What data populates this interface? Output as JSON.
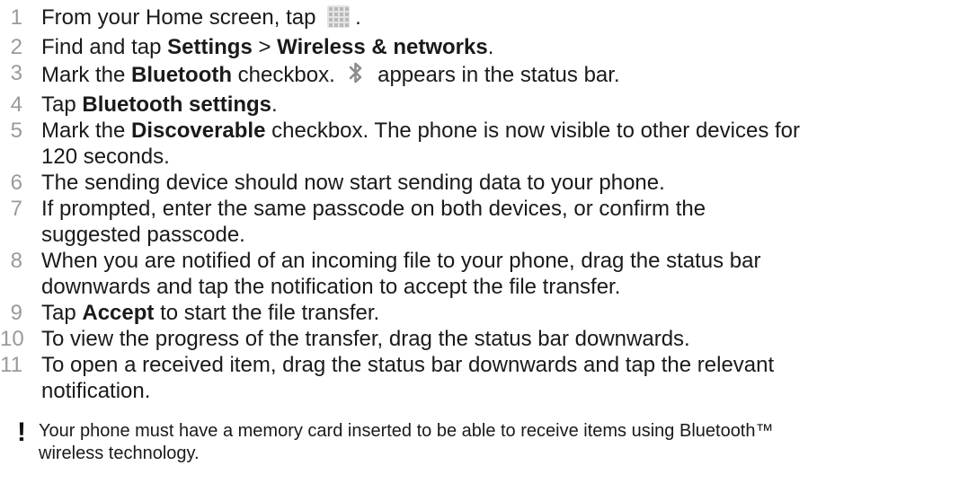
{
  "steps": [
    {
      "num": "1",
      "parts": [
        {
          "t": "text",
          "v": "From your Home screen, tap "
        },
        {
          "t": "icon",
          "v": "app-grid-icon"
        },
        {
          "t": "text",
          "v": "."
        }
      ]
    },
    {
      "num": "2",
      "parts": [
        {
          "t": "text",
          "v": "Find and tap "
        },
        {
          "t": "bold",
          "v": "Settings"
        },
        {
          "t": "text",
          "v": " > "
        },
        {
          "t": "bold",
          "v": "Wireless & networks"
        },
        {
          "t": "text",
          "v": "."
        }
      ]
    },
    {
      "num": "3",
      "parts": [
        {
          "t": "text",
          "v": "Mark the "
        },
        {
          "t": "bold",
          "v": "Bluetooth"
        },
        {
          "t": "text",
          "v": " checkbox. "
        },
        {
          "t": "icon",
          "v": "bluetooth-icon"
        },
        {
          "t": "text",
          "v": " appears in the status bar."
        }
      ]
    },
    {
      "num": "4",
      "parts": [
        {
          "t": "text",
          "v": "Tap "
        },
        {
          "t": "bold",
          "v": "Bluetooth settings"
        },
        {
          "t": "text",
          "v": "."
        }
      ]
    },
    {
      "num": "5",
      "parts": [
        {
          "t": "text",
          "v": "Mark the "
        },
        {
          "t": "bold",
          "v": "Discoverable"
        },
        {
          "t": "text",
          "v": " checkbox. The phone is now visible to other devices for"
        },
        {
          "t": "br"
        },
        {
          "t": "text",
          "v": "120 seconds."
        }
      ]
    },
    {
      "num": "6",
      "parts": [
        {
          "t": "text",
          "v": "The sending device should now start sending data to your phone."
        }
      ]
    },
    {
      "num": "7",
      "parts": [
        {
          "t": "text",
          "v": "If prompted, enter the same passcode on both devices, or confirm the"
        },
        {
          "t": "br"
        },
        {
          "t": "text",
          "v": "suggested passcode."
        }
      ]
    },
    {
      "num": "8",
      "parts": [
        {
          "t": "text",
          "v": "When you are notified of an incoming file to your phone, drag the status bar"
        },
        {
          "t": "br"
        },
        {
          "t": "text",
          "v": "downwards and tap the notification to accept the file transfer."
        }
      ]
    },
    {
      "num": "9",
      "parts": [
        {
          "t": "text",
          "v": "Tap "
        },
        {
          "t": "bold",
          "v": "Accept"
        },
        {
          "t": "text",
          "v": " to start the file transfer."
        }
      ]
    },
    {
      "num": "10",
      "parts": [
        {
          "t": "text",
          "v": "To view the progress of the transfer, drag the status bar downwards."
        }
      ]
    },
    {
      "num": "11",
      "parts": [
        {
          "t": "text",
          "v": "To open a received item, drag the status bar downwards and tap the relevant"
        },
        {
          "t": "br"
        },
        {
          "t": "text",
          "v": "notification."
        }
      ]
    }
  ],
  "note": {
    "icon": "exclamation-icon",
    "glyph": "!",
    "lines": [
      "Your phone must have a memory card inserted to be able to receive items using Bluetooth™",
      "wireless technology."
    ]
  }
}
